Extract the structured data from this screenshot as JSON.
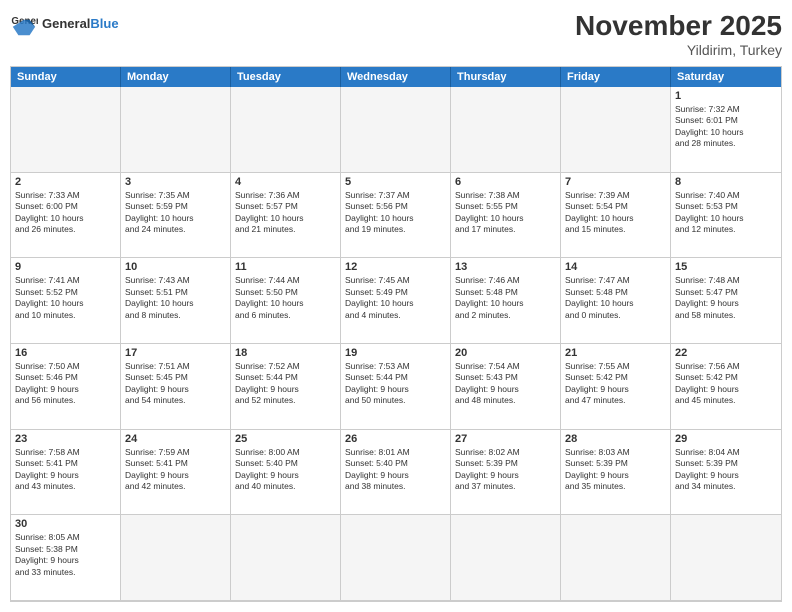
{
  "header": {
    "logo_general": "General",
    "logo_blue": "Blue",
    "month_year": "November 2025",
    "location": "Yildirim, Turkey"
  },
  "days": [
    "Sunday",
    "Monday",
    "Tuesday",
    "Wednesday",
    "Thursday",
    "Friday",
    "Saturday"
  ],
  "cells": [
    {
      "day": null,
      "empty": true
    },
    {
      "day": null,
      "empty": true
    },
    {
      "day": null,
      "empty": true
    },
    {
      "day": null,
      "empty": true
    },
    {
      "day": null,
      "empty": true
    },
    {
      "day": null,
      "empty": true
    },
    {
      "day": 1,
      "info": "Sunrise: 7:32 AM\nSunset: 6:01 PM\nDaylight: 10 hours\nand 28 minutes."
    },
    {
      "day": 2,
      "info": "Sunrise: 7:33 AM\nSunset: 6:00 PM\nDaylight: 10 hours\nand 26 minutes."
    },
    {
      "day": 3,
      "info": "Sunrise: 7:35 AM\nSunset: 5:59 PM\nDaylight: 10 hours\nand 24 minutes."
    },
    {
      "day": 4,
      "info": "Sunrise: 7:36 AM\nSunset: 5:57 PM\nDaylight: 10 hours\nand 21 minutes."
    },
    {
      "day": 5,
      "info": "Sunrise: 7:37 AM\nSunset: 5:56 PM\nDaylight: 10 hours\nand 19 minutes."
    },
    {
      "day": 6,
      "info": "Sunrise: 7:38 AM\nSunset: 5:55 PM\nDaylight: 10 hours\nand 17 minutes."
    },
    {
      "day": 7,
      "info": "Sunrise: 7:39 AM\nSunset: 5:54 PM\nDaylight: 10 hours\nand 15 minutes."
    },
    {
      "day": 8,
      "info": "Sunrise: 7:40 AM\nSunset: 5:53 PM\nDaylight: 10 hours\nand 12 minutes."
    },
    {
      "day": 9,
      "info": "Sunrise: 7:41 AM\nSunset: 5:52 PM\nDaylight: 10 hours\nand 10 minutes."
    },
    {
      "day": 10,
      "info": "Sunrise: 7:43 AM\nSunset: 5:51 PM\nDaylight: 10 hours\nand 8 minutes."
    },
    {
      "day": 11,
      "info": "Sunrise: 7:44 AM\nSunset: 5:50 PM\nDaylight: 10 hours\nand 6 minutes."
    },
    {
      "day": 12,
      "info": "Sunrise: 7:45 AM\nSunset: 5:49 PM\nDaylight: 10 hours\nand 4 minutes."
    },
    {
      "day": 13,
      "info": "Sunrise: 7:46 AM\nSunset: 5:48 PM\nDaylight: 10 hours\nand 2 minutes."
    },
    {
      "day": 14,
      "info": "Sunrise: 7:47 AM\nSunset: 5:48 PM\nDaylight: 10 hours\nand 0 minutes."
    },
    {
      "day": 15,
      "info": "Sunrise: 7:48 AM\nSunset: 5:47 PM\nDaylight: 9 hours\nand 58 minutes."
    },
    {
      "day": 16,
      "info": "Sunrise: 7:50 AM\nSunset: 5:46 PM\nDaylight: 9 hours\nand 56 minutes."
    },
    {
      "day": 17,
      "info": "Sunrise: 7:51 AM\nSunset: 5:45 PM\nDaylight: 9 hours\nand 54 minutes."
    },
    {
      "day": 18,
      "info": "Sunrise: 7:52 AM\nSunset: 5:44 PM\nDaylight: 9 hours\nand 52 minutes."
    },
    {
      "day": 19,
      "info": "Sunrise: 7:53 AM\nSunset: 5:44 PM\nDaylight: 9 hours\nand 50 minutes."
    },
    {
      "day": 20,
      "info": "Sunrise: 7:54 AM\nSunset: 5:43 PM\nDaylight: 9 hours\nand 48 minutes."
    },
    {
      "day": 21,
      "info": "Sunrise: 7:55 AM\nSunset: 5:42 PM\nDaylight: 9 hours\nand 47 minutes."
    },
    {
      "day": 22,
      "info": "Sunrise: 7:56 AM\nSunset: 5:42 PM\nDaylight: 9 hours\nand 45 minutes."
    },
    {
      "day": 23,
      "info": "Sunrise: 7:58 AM\nSunset: 5:41 PM\nDaylight: 9 hours\nand 43 minutes."
    },
    {
      "day": 24,
      "info": "Sunrise: 7:59 AM\nSunset: 5:41 PM\nDaylight: 9 hours\nand 42 minutes."
    },
    {
      "day": 25,
      "info": "Sunrise: 8:00 AM\nSunset: 5:40 PM\nDaylight: 9 hours\nand 40 minutes."
    },
    {
      "day": 26,
      "info": "Sunrise: 8:01 AM\nSunset: 5:40 PM\nDaylight: 9 hours\nand 38 minutes."
    },
    {
      "day": 27,
      "info": "Sunrise: 8:02 AM\nSunset: 5:39 PM\nDaylight: 9 hours\nand 37 minutes."
    },
    {
      "day": 28,
      "info": "Sunrise: 8:03 AM\nSunset: 5:39 PM\nDaylight: 9 hours\nand 35 minutes."
    },
    {
      "day": 29,
      "info": "Sunrise: 8:04 AM\nSunset: 5:39 PM\nDaylight: 9 hours\nand 34 minutes."
    },
    {
      "day": 30,
      "info": "Sunrise: 8:05 AM\nSunset: 5:38 PM\nDaylight: 9 hours\nand 33 minutes."
    },
    {
      "day": null,
      "empty": true
    },
    {
      "day": null,
      "empty": true
    },
    {
      "day": null,
      "empty": true
    },
    {
      "day": null,
      "empty": true
    },
    {
      "day": null,
      "empty": true
    },
    {
      "day": null,
      "empty": true
    }
  ]
}
